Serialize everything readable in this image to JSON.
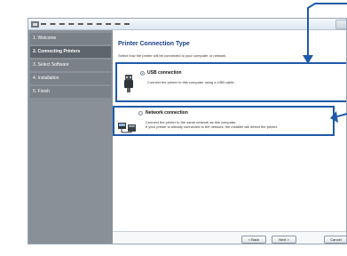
{
  "sidebar": {
    "items": [
      {
        "label": "1. Welcome"
      },
      {
        "label": "2. Connecting Printers"
      },
      {
        "label": "3. Select Software"
      },
      {
        "label": "4. Installation"
      },
      {
        "label": "5. Finish"
      }
    ]
  },
  "main": {
    "title": "Printer Connection Type",
    "subtitle": "Select how the printer will be connected to your computer or network.",
    "options": [
      {
        "label": "USB connection",
        "description": "Connect the printer to this computer using a USB cable.",
        "selected": true,
        "icon": "usb-cable-icon"
      },
      {
        "label": "Network connection",
        "description_line1": "Connect the printer to the same network as this computer.",
        "description_line2": "If your printer is already connected to the network, the installer will detect the printer.",
        "selected": false,
        "icon": "network-icon"
      }
    ]
  },
  "footer": {
    "back_label": "< Back",
    "next_label": "Next >",
    "cancel_label": "Cancel"
  },
  "colors": {
    "callout": "#1e5aa8",
    "sidebar": "#8a9098",
    "title": "#1b3e8c"
  }
}
